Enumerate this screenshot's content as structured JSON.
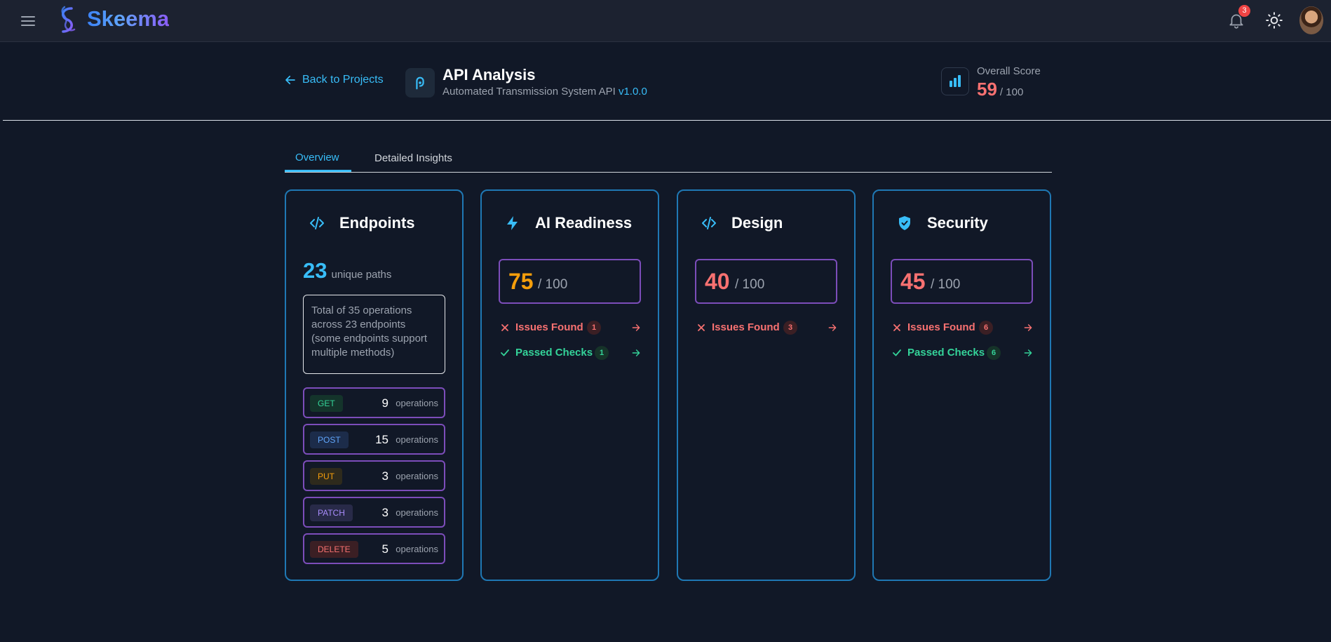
{
  "app": {
    "name": "Skeema",
    "notifications": "3"
  },
  "header": {
    "back": "Back to Projects",
    "title": "API Analysis",
    "subtitle": "Automated Transmission System API",
    "version": "v1.0.0",
    "score_label": "Overall Score",
    "score": "59",
    "score_max": "/ 100"
  },
  "tabs": {
    "overview": "Overview",
    "insights": "Detailed Insights",
    "active": "Overview"
  },
  "endpoints": {
    "title": "Endpoints",
    "count": "23",
    "count_label": "unique paths",
    "summary": "Total of 35 operations across 23 endpoints (some endpoints support multiple methods)",
    "ops_label": "operations",
    "methods": [
      {
        "method": "GET",
        "count": "9"
      },
      {
        "method": "POST",
        "count": "15"
      },
      {
        "method": "PUT",
        "count": "3"
      },
      {
        "method": "PATCH",
        "count": "3"
      },
      {
        "method": "DELETE",
        "count": "5"
      }
    ]
  },
  "ai": {
    "title": "AI Readiness",
    "score": "75",
    "max": "/ 100",
    "issues_label": "Issues Found",
    "issues": "1",
    "passed_label": "Passed Checks",
    "passed": "1"
  },
  "design": {
    "title": "Design",
    "score": "40",
    "max": "/ 100",
    "issues_label": "Issues Found",
    "issues": "3"
  },
  "security": {
    "title": "Security",
    "score": "45",
    "max": "/ 100",
    "issues_label": "Issues Found",
    "issues": "6",
    "passed_label": "Passed Checks",
    "passed": "6"
  },
  "colors": {
    "accent": "#38bdf8",
    "card_border": "#1f78b4",
    "box_border": "#7c4dba",
    "danger": "#f87171",
    "success": "#34d399",
    "warning": "#f59e0b"
  },
  "icons": [
    "menu-icon",
    "logo-icon",
    "bell-icon",
    "sun-icon",
    "arrow-left-icon",
    "api-icon",
    "bar-chart-icon",
    "code-icon",
    "bolt-icon",
    "shield-icon",
    "x-icon",
    "check-icon",
    "arrow-right-icon"
  ]
}
